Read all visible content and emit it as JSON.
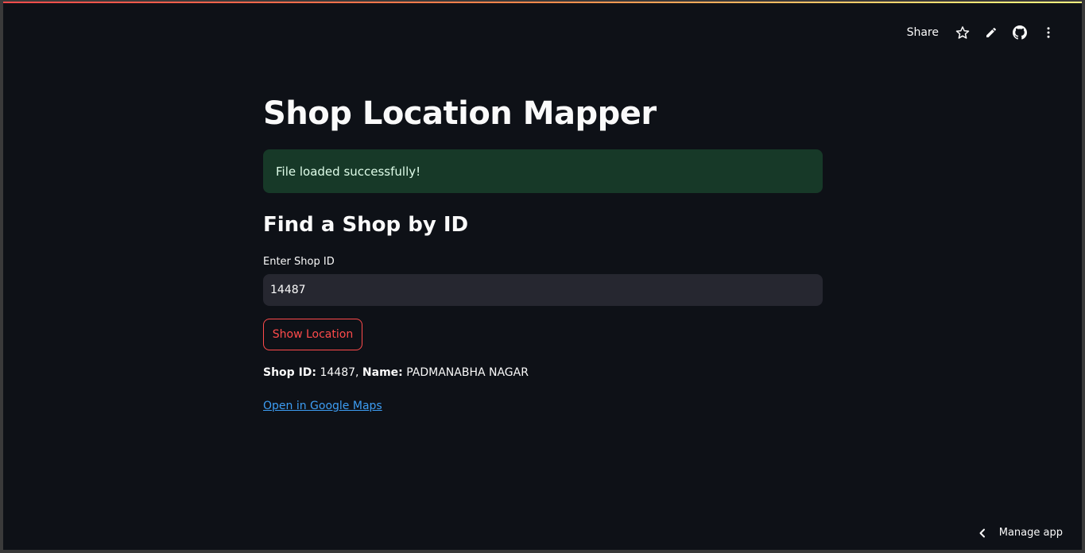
{
  "toolbar": {
    "share_label": "Share",
    "icons": [
      "star-icon",
      "pencil-icon",
      "github-icon",
      "more-vertical-icon"
    ]
  },
  "page": {
    "title": "Shop Location Mapper",
    "alert_text": "File loaded successfully!",
    "subheader": "Find a Shop by ID"
  },
  "form": {
    "label": "Enter Shop ID",
    "value": "14487",
    "button_label": "Show Location"
  },
  "result": {
    "id_label": "Shop ID",
    "id_value": "14487",
    "name_label": "Name",
    "name_value": "PADMANABHA NAGAR"
  },
  "link": {
    "text": "Open in Google Maps"
  },
  "footer": {
    "manage_label": "Manage app"
  },
  "colors": {
    "background": "#0e1117",
    "accent": "#ff4b4b",
    "success_bg": "#173928",
    "input_bg": "#262730",
    "link": "#3d9df3"
  }
}
